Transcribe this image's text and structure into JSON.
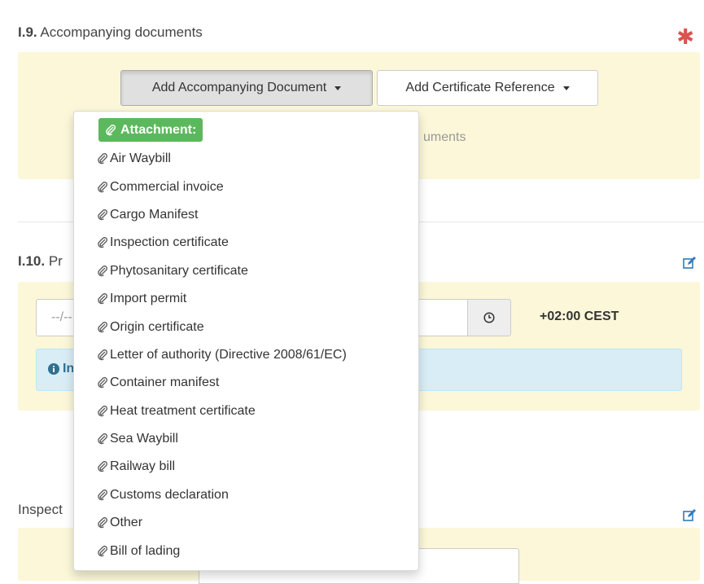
{
  "section_i9": {
    "number": "I.9.",
    "title": "Accompanying documents",
    "required_mark": "✱",
    "add_document_button": "Add Accompanying Document",
    "add_certificate_button": "Add Certificate Reference",
    "behind_text": "uments"
  },
  "section_i10": {
    "number": "I.10.",
    "title_partial": "Pr",
    "date_placeholder": "--/--",
    "timezone": "+02:00 CEST",
    "info_partial": "In"
  },
  "inspection_section": {
    "title_partial": "Inspect"
  },
  "dropdown": {
    "header": "Attachment:",
    "items": [
      "Air Waybill",
      "Commercial invoice",
      "Cargo Manifest",
      "Inspection certificate",
      "Phytosanitary certificate",
      "Import permit",
      "Origin certificate",
      "Letter of authority (Directive 2008/61/EC)",
      "Container manifest",
      "Heat treatment certificate",
      "Sea Waybill",
      "Railway bill",
      "Customs declaration",
      "Other",
      "Bill of lading"
    ]
  },
  "colors": {
    "panel_bg": "#fbf7d8",
    "required": "#d9534f",
    "header_green": "#5cb85c",
    "edit_icon": "#337ab7",
    "info_bg": "#d9edf7"
  },
  "icons": [
    "paperclip-icon",
    "caret-down-icon",
    "clock-icon",
    "edit-icon",
    "info-circle-icon",
    "required-asterisk-icon"
  ]
}
